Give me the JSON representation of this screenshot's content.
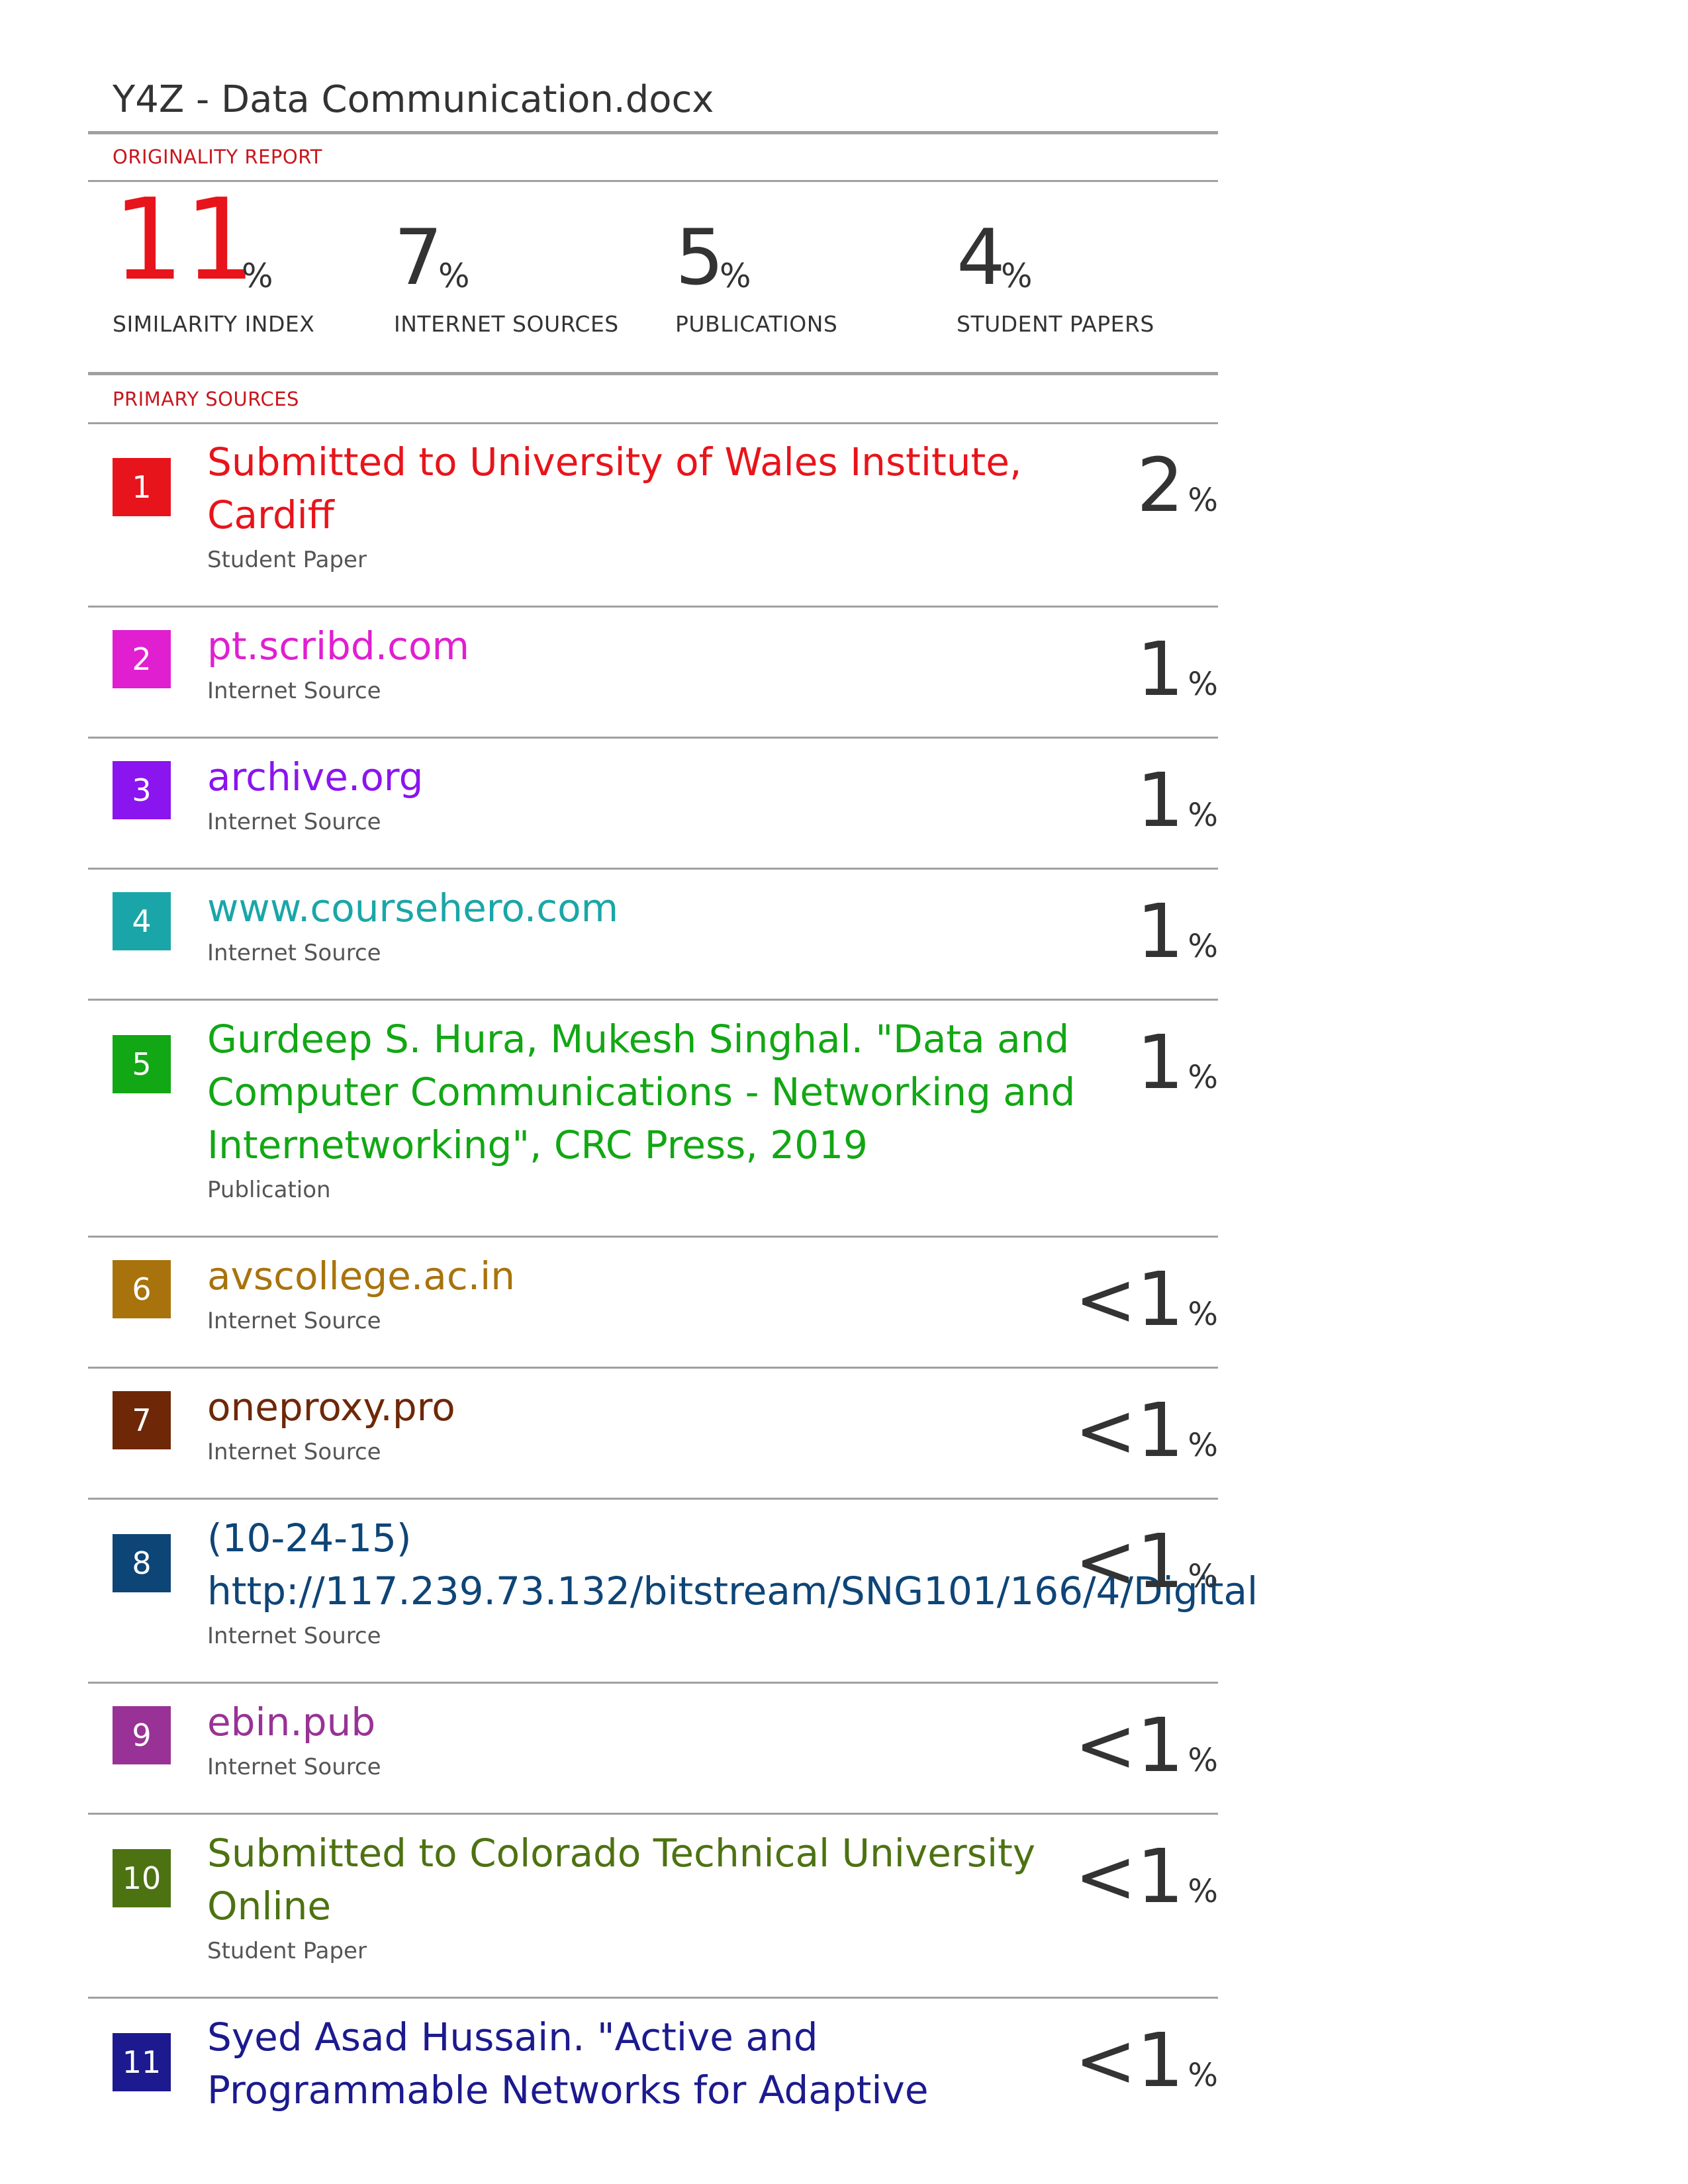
{
  "document": {
    "title": "Y4Z - Data Communication.docx"
  },
  "originality_report": {
    "heading": "ORIGINALITY REPORT",
    "similarity_index": {
      "value": "11",
      "unit": "%",
      "label": "SIMILARITY INDEX"
    },
    "internet_sources": {
      "value": "7",
      "unit": "%",
      "label": "INTERNET SOURCES"
    },
    "publications": {
      "value": "5",
      "unit": "%",
      "label": "PUBLICATIONS"
    },
    "student_papers": {
      "value": "4",
      "unit": "%",
      "label": "STUDENT PAPERS"
    }
  },
  "primary_sources": {
    "heading": "PRIMARY SOURCES",
    "items": [
      {
        "number": "1",
        "title_lines": [
          "Submitted to University of Wales Institute,",
          "Cardiff"
        ],
        "type": "Student Paper",
        "percent": "2",
        "unit": "%",
        "color": "#e8141b"
      },
      {
        "number": "2",
        "title_lines": [
          "pt.scribd.com"
        ],
        "type": "Internet Source",
        "percent": "1",
        "unit": "%",
        "color": "#e01fd0"
      },
      {
        "number": "3",
        "title_lines": [
          "archive.org"
        ],
        "type": "Internet Source",
        "percent": "1",
        "unit": "%",
        "color": "#8a15ee"
      },
      {
        "number": "4",
        "title_lines": [
          "www.coursehero.com"
        ],
        "type": "Internet Source",
        "percent": "1",
        "unit": "%",
        "color": "#1aa6a8"
      },
      {
        "number": "5",
        "title_lines": [
          "Gurdeep S. Hura, Mukesh Singhal. \"Data and",
          "Computer Communications - Networking and",
          "Internetworking\", CRC Press, 2019"
        ],
        "type": "Publication",
        "percent": "1",
        "unit": "%",
        "color": "#12a714"
      },
      {
        "number": "6",
        "title_lines": [
          "avscollege.ac.in"
        ],
        "type": "Internet Source",
        "percent": "<1",
        "unit": "%",
        "color": "#a8730d"
      },
      {
        "number": "7",
        "title_lines": [
          "oneproxy.pro"
        ],
        "type": "Internet Source",
        "percent": "<1",
        "unit": "%",
        "color": "#6e2808"
      },
      {
        "number": "8",
        "title_lines": [
          "(10-24-15)",
          "http://117.239.73.132/bitstream/SNG101/166/4/Digital"
        ],
        "type": "Internet Source",
        "percent": "<1",
        "unit": "%",
        "color": "#0e4577"
      },
      {
        "number": "9",
        "title_lines": [
          "ebin.pub"
        ],
        "type": "Internet Source",
        "percent": "<1",
        "unit": "%",
        "color": "#993296"
      },
      {
        "number": "10",
        "title_lines": [
          "Submitted to Colorado Technical University",
          "Online"
        ],
        "type": "Student Paper",
        "percent": "<1",
        "unit": "%",
        "color": "#4d7212"
      },
      {
        "number": "11",
        "title_lines": [
          "Syed Asad Hussain. \"Active and",
          "Programmable Networks for Adaptive"
        ],
        "type": "",
        "percent": "<1",
        "unit": "%",
        "color": "#1c1a8e"
      }
    ]
  }
}
